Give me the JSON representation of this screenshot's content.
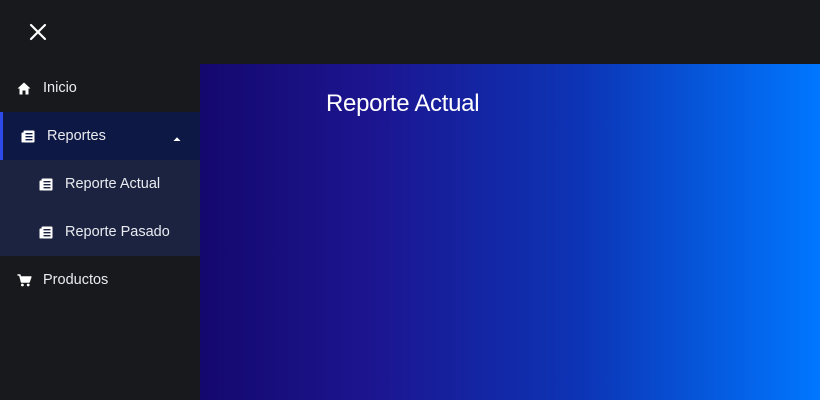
{
  "topbar": {
    "close_icon": "close-icon"
  },
  "sidebar": {
    "items": [
      {
        "label": "Inicio",
        "icon": "home-icon"
      },
      {
        "label": "Reportes",
        "icon": "report-icon",
        "expanded": true,
        "children": [
          {
            "label": "Reporte Actual",
            "icon": "report-icon"
          },
          {
            "label": "Reporte Pasado",
            "icon": "report-icon"
          }
        ]
      },
      {
        "label": "Productos",
        "icon": "cart-icon"
      }
    ]
  },
  "main": {
    "title": "Reporte Actual"
  },
  "colors": {
    "background": "#18191d",
    "active_bg": "#0e1844",
    "active_border": "#2f49e8",
    "submenu_bg": "#1b2340",
    "gradient_start": "#14086e",
    "gradient_end": "#0077ff"
  }
}
